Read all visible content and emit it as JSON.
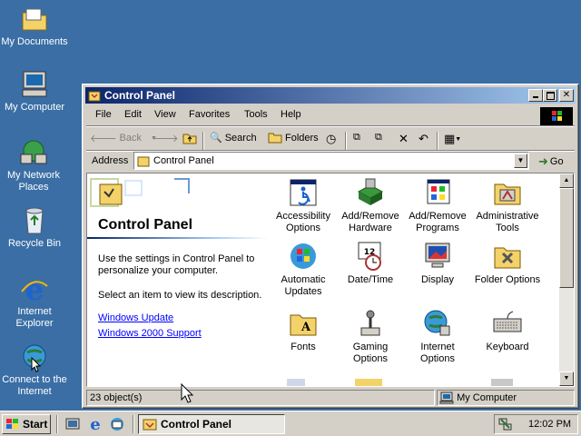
{
  "desktop": {
    "icons": [
      {
        "label": "My Documents"
      },
      {
        "label": "My Computer"
      },
      {
        "label": "My Network Places"
      },
      {
        "label": "Recycle Bin"
      },
      {
        "label": "Internet Explorer"
      },
      {
        "label": "Connect to the Internet"
      }
    ]
  },
  "window": {
    "title": "Control Panel",
    "menu": [
      "File",
      "Edit",
      "View",
      "Favorites",
      "Tools",
      "Help"
    ],
    "toolbar": {
      "back": "Back",
      "search": "Search",
      "folders": "Folders"
    },
    "address": {
      "label": "Address",
      "value": "Control Panel",
      "go": "Go"
    },
    "left_pane": {
      "title": "Control Panel",
      "description": "Use the settings in Control Panel to personalize your computer.",
      "instruction": "Select an item to view its description.",
      "links": [
        "Windows Update",
        "Windows 2000 Support"
      ]
    },
    "items": [
      {
        "label": "Accessibility Options",
        "icon": "accessibility-icon"
      },
      {
        "label": "Add/Remove Hardware",
        "icon": "add-hardware-icon"
      },
      {
        "label": "Add/Remove Programs",
        "icon": "add-programs-icon"
      },
      {
        "label": "Administrative Tools",
        "icon": "admin-tools-icon"
      },
      {
        "label": "Automatic Updates",
        "icon": "windows-update-icon"
      },
      {
        "label": "Date/Time",
        "icon": "calendar-clock-icon"
      },
      {
        "label": "Display",
        "icon": "monitor-icon"
      },
      {
        "label": "Folder Options",
        "icon": "folder-options-icon"
      },
      {
        "label": "Fonts",
        "icon": "fonts-folder-icon"
      },
      {
        "label": "Gaming Options",
        "icon": "joystick-icon"
      },
      {
        "label": "Internet Options",
        "icon": "globe-icon"
      },
      {
        "label": "Keyboard",
        "icon": "keyboard-icon"
      }
    ],
    "status": {
      "count": "23 object(s)",
      "zone": "My Computer"
    }
  },
  "taskbar": {
    "start": "Start",
    "active_task": "Control Panel",
    "clock": "12:02 PM"
  },
  "colors": {
    "desktop": "#3a6ea5",
    "title_active": "#0a246a",
    "title_gradient_end": "#a6caf0",
    "chrome": "#d4d0c8",
    "link": "#0000ff"
  }
}
